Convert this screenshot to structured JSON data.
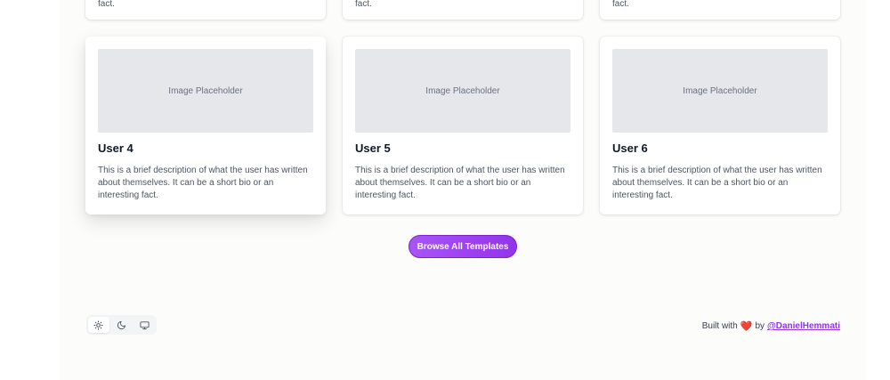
{
  "top_cards": [
    {
      "desc_tail": "fact."
    },
    {
      "desc_tail": "fact."
    },
    {
      "desc_tail": "fact."
    }
  ],
  "cards": [
    {
      "image_label": "Image Placeholder",
      "title": "User 4",
      "description": "This is a brief description of what the user has written about themselves. It can be a short bio or an interesting fact."
    },
    {
      "image_label": "Image Placeholder",
      "title": "User 5",
      "description": "This is a brief description of what the user has written about themselves. It can be a short bio or an interesting fact."
    },
    {
      "image_label": "Image Placeholder",
      "title": "User 6",
      "description": "This is a brief description of what the user has written about themselves. It can be a short bio or an interesting fact."
    }
  ],
  "browse_button": {
    "label": "Browse All Templates",
    "color": "#a855f7"
  },
  "theme_toggle": {
    "options": [
      {
        "icon": "sun-icon",
        "active": true
      },
      {
        "icon": "moon-icon",
        "active": false
      },
      {
        "icon": "monitor-icon",
        "active": false
      }
    ]
  },
  "footer": {
    "built_with": "Built with",
    "heart": "❤️",
    "by": "by",
    "author": "@DanielHemmati"
  }
}
